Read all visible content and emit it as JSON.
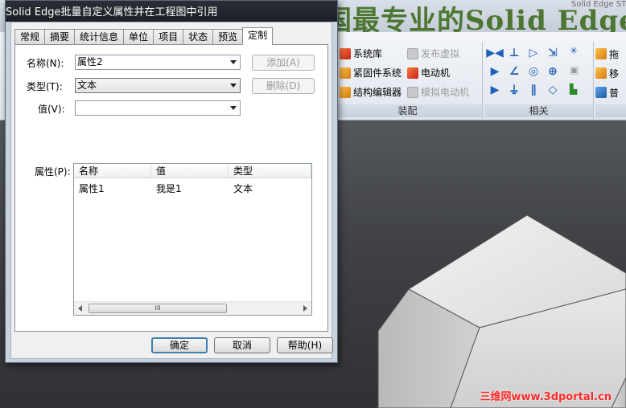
{
  "background_app": {
    "banner": "中国最专业的Solid Edge",
    "window_small_title": "Solid Edge ST",
    "ribbon": {
      "groups": [
        {
          "label": "装配",
          "items": [
            {
              "label": "系统库",
              "icon": "library-icon",
              "enabled": true
            },
            {
              "label": "紧固件系统",
              "icon": "fastener-icon",
              "enabled": true
            },
            {
              "label": "结构编辑器",
              "icon": "structure-editor-icon",
              "enabled": true
            },
            {
              "label": "发布虚拟",
              "icon": "publish-virtual-icon",
              "enabled": false
            },
            {
              "label": "电动机",
              "icon": "motor-icon",
              "enabled": true
            },
            {
              "label": "模拟电动机",
              "icon": "simulate-motor-icon",
              "enabled": false
            }
          ]
        },
        {
          "label": "相关"
        }
      ],
      "partial_items": [
        "拖",
        "移",
        "普"
      ]
    }
  },
  "dialog": {
    "title": "Solid Edge批量自定义属性并在工程图中引用",
    "tabs": [
      {
        "label": "常规",
        "active": false
      },
      {
        "label": "摘要",
        "active": false
      },
      {
        "label": "统计信息",
        "active": false
      },
      {
        "label": "单位",
        "active": false
      },
      {
        "label": "项目",
        "active": false
      },
      {
        "label": "状态",
        "active": false
      },
      {
        "label": "预览",
        "active": false
      },
      {
        "label": "定制",
        "active": true
      }
    ],
    "fields": {
      "name": {
        "label": "名称(N):",
        "value": "属性2"
      },
      "type": {
        "label": "类型(T):",
        "value": "文本"
      },
      "value": {
        "label": "值(V):",
        "value": ""
      }
    },
    "buttons": {
      "add": "添加(A)",
      "delete": "删除(D)"
    },
    "properties_label": "属性(P):",
    "properties_table": {
      "columns": [
        "名称",
        "值",
        "类型"
      ],
      "rows": [
        {
          "name": "属性1",
          "value": "我是1",
          "type": "文本"
        }
      ]
    },
    "scroll_thumb_glyph": "III",
    "footer": {
      "ok": "确定",
      "cancel": "取消",
      "help": "帮助(H)"
    }
  },
  "watermark": "三维网www.3dportal.cn",
  "colors": {
    "banner_green": "#3f6d1f",
    "watermark_red": "#ff2a2a",
    "default_button_border": "#3c7fb1"
  }
}
